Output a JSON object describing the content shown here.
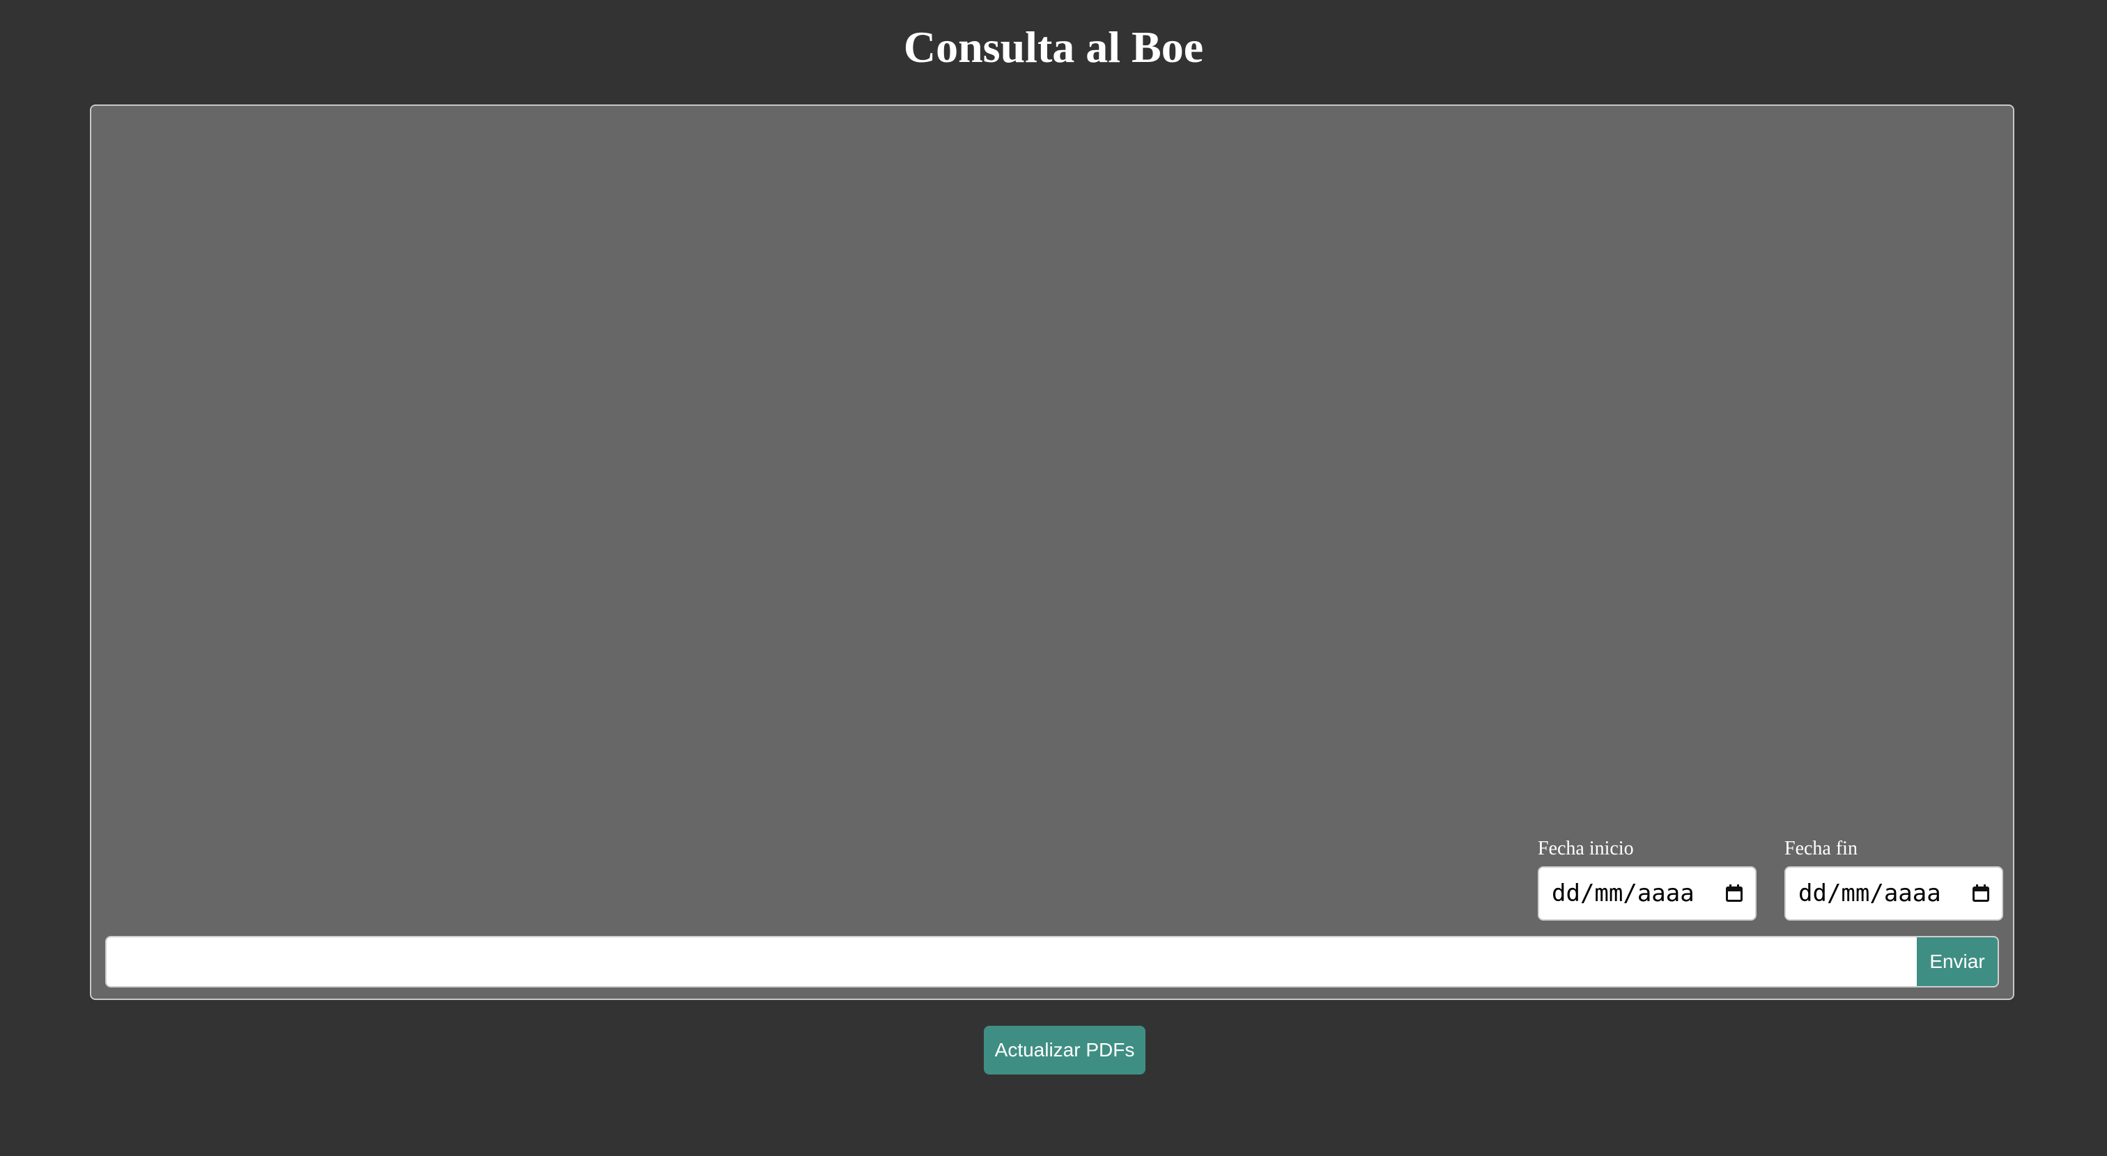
{
  "header": {
    "title": "Consulta al Boe"
  },
  "chat": {
    "messages": []
  },
  "filters": {
    "start_date_label": "Fecha inicio",
    "start_date_placeholder": "dd/mm/aaaa",
    "end_date_label": "Fecha fin",
    "end_date_placeholder": "dd/mm/aaaa",
    "calendar_icon": "calendar-icon"
  },
  "query": {
    "value": "",
    "placeholder": "",
    "send_label": "Enviar"
  },
  "actions": {
    "update_label": "Actualizar PDFs"
  },
  "colors": {
    "page_background": "#333333",
    "panel_background": "#676767",
    "accent": "#3f8e83",
    "text": "#ffffff"
  }
}
